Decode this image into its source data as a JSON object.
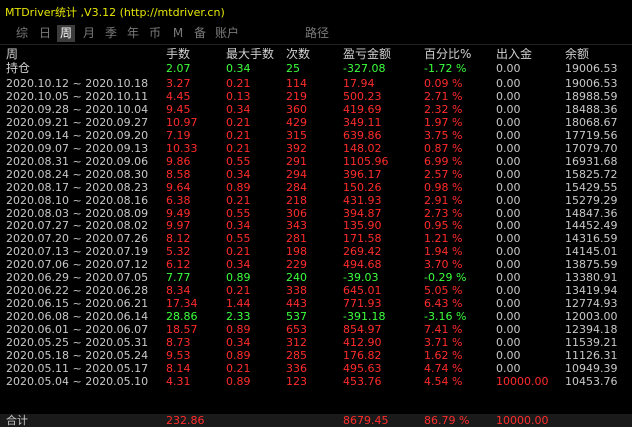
{
  "window": {
    "title": "MTDriver统计 ,V3.12 (http://mtdriver.cn)"
  },
  "tabs": [
    {
      "label": "综",
      "active": false
    },
    {
      "label": "日",
      "active": false
    },
    {
      "label": "周",
      "active": true
    },
    {
      "label": "月",
      "active": false
    },
    {
      "label": "季",
      "active": false
    },
    {
      "label": "年",
      "active": false
    },
    {
      "label": "币",
      "active": false
    },
    {
      "label": "M",
      "active": false
    },
    {
      "label": "备",
      "active": false
    },
    {
      "label": "账户",
      "active": false
    },
    {
      "label": "路径",
      "active": false
    }
  ],
  "table": {
    "headers": [
      "周",
      "手数",
      "最大手数",
      "次数",
      "盈亏金额",
      "百分比%",
      "出入金",
      "余额"
    ],
    "position_row": [
      "持仓",
      "2.07",
      "0.34",
      "25",
      "-327.08",
      "-1.72 %",
      "0.00",
      "19006.53"
    ],
    "rows": [
      [
        "2020.10.12 ~ 2020.10.18",
        "3.27",
        "0.21",
        "114",
        "17.94",
        "0.09 %",
        "0.00",
        "19006.53"
      ],
      [
        "2020.10.05 ~ 2020.10.11",
        "4.45",
        "0.13",
        "219",
        "500.23",
        "2.71 %",
        "0.00",
        "18988.59"
      ],
      [
        "2020.09.28 ~ 2020.10.04",
        "9.45",
        "0.34",
        "360",
        "419.69",
        "2.32 %",
        "0.00",
        "18488.36"
      ],
      [
        "2020.09.21 ~ 2020.09.27",
        "10.97",
        "0.21",
        "429",
        "349.11",
        "1.97 %",
        "0.00",
        "18068.67"
      ],
      [
        "2020.09.14 ~ 2020.09.20",
        "7.19",
        "0.21",
        "315",
        "639.86",
        "3.75 %",
        "0.00",
        "17719.56"
      ],
      [
        "2020.09.07 ~ 2020.09.13",
        "10.33",
        "0.21",
        "392",
        "148.02",
        "0.87 %",
        "0.00",
        "17079.70"
      ],
      [
        "2020.08.31 ~ 2020.09.06",
        "9.86",
        "0.55",
        "291",
        "1105.96",
        "6.99 %",
        "0.00",
        "16931.68"
      ],
      [
        "2020.08.24 ~ 2020.08.30",
        "8.58",
        "0.34",
        "294",
        "396.17",
        "2.57 %",
        "0.00",
        "15825.72"
      ],
      [
        "2020.08.17 ~ 2020.08.23",
        "9.64",
        "0.89",
        "284",
        "150.26",
        "0.98 %",
        "0.00",
        "15429.55"
      ],
      [
        "2020.08.10 ~ 2020.08.16",
        "6.38",
        "0.21",
        "218",
        "431.93",
        "2.91 %",
        "0.00",
        "15279.29"
      ],
      [
        "2020.08.03 ~ 2020.08.09",
        "9.49",
        "0.55",
        "306",
        "394.87",
        "2.73 %",
        "0.00",
        "14847.36"
      ],
      [
        "2020.07.27 ~ 2020.08.02",
        "9.97",
        "0.34",
        "343",
        "135.90",
        "0.95 %",
        "0.00",
        "14452.49"
      ],
      [
        "2020.07.20 ~ 2020.07.26",
        "8.12",
        "0.55",
        "281",
        "171.58",
        "1.21 %",
        "0.00",
        "14316.59"
      ],
      [
        "2020.07.13 ~ 2020.07.19",
        "5.32",
        "0.21",
        "198",
        "269.42",
        "1.94 %",
        "0.00",
        "14145.01"
      ],
      [
        "2020.07.06 ~ 2020.07.12",
        "6.12",
        "0.34",
        "229",
        "494.68",
        "3.70 %",
        "0.00",
        "13875.59"
      ],
      [
        "2020.06.29 ~ 2020.07.05",
        "7.77",
        "0.89",
        "240",
        "-39.03",
        "-0.29 %",
        "0.00",
        "13380.91"
      ],
      [
        "2020.06.22 ~ 2020.06.28",
        "8.34",
        "0.21",
        "338",
        "645.01",
        "5.05 %",
        "0.00",
        "13419.94"
      ],
      [
        "2020.06.15 ~ 2020.06.21",
        "17.34",
        "1.44",
        "443",
        "771.93",
        "6.43 %",
        "0.00",
        "12774.93"
      ],
      [
        "2020.06.08 ~ 2020.06.14",
        "28.86",
        "2.33",
        "537",
        "-391.18",
        "-3.16 %",
        "0.00",
        "12003.00"
      ],
      [
        "2020.06.01 ~ 2020.06.07",
        "18.57",
        "0.89",
        "653",
        "854.97",
        "7.41 %",
        "0.00",
        "12394.18"
      ],
      [
        "2020.05.25 ~ 2020.05.31",
        "8.73",
        "0.34",
        "312",
        "412.90",
        "3.71 %",
        "0.00",
        "11539.21"
      ],
      [
        "2020.05.18 ~ 2020.05.24",
        "9.53",
        "0.89",
        "285",
        "176.82",
        "1.62 %",
        "0.00",
        "11126.31"
      ],
      [
        "2020.05.11 ~ 2020.05.17",
        "8.14",
        "0.21",
        "336",
        "495.63",
        "4.74 %",
        "0.00",
        "10949.39"
      ],
      [
        "2020.05.04 ~ 2020.05.10",
        "4.31",
        "0.89",
        "123",
        "453.76",
        "4.54 %",
        "10000.00",
        "10453.76"
      ]
    ],
    "total_row": [
      "合计",
      "232.86",
      "",
      "",
      "8679.45",
      "86.79 %",
      "10000.00",
      ""
    ]
  },
  "colors": {
    "positive": "#ff2b2b",
    "negative": "#3cff3c",
    "title": "#e6e600",
    "neutral": "#c8c8c8"
  }
}
